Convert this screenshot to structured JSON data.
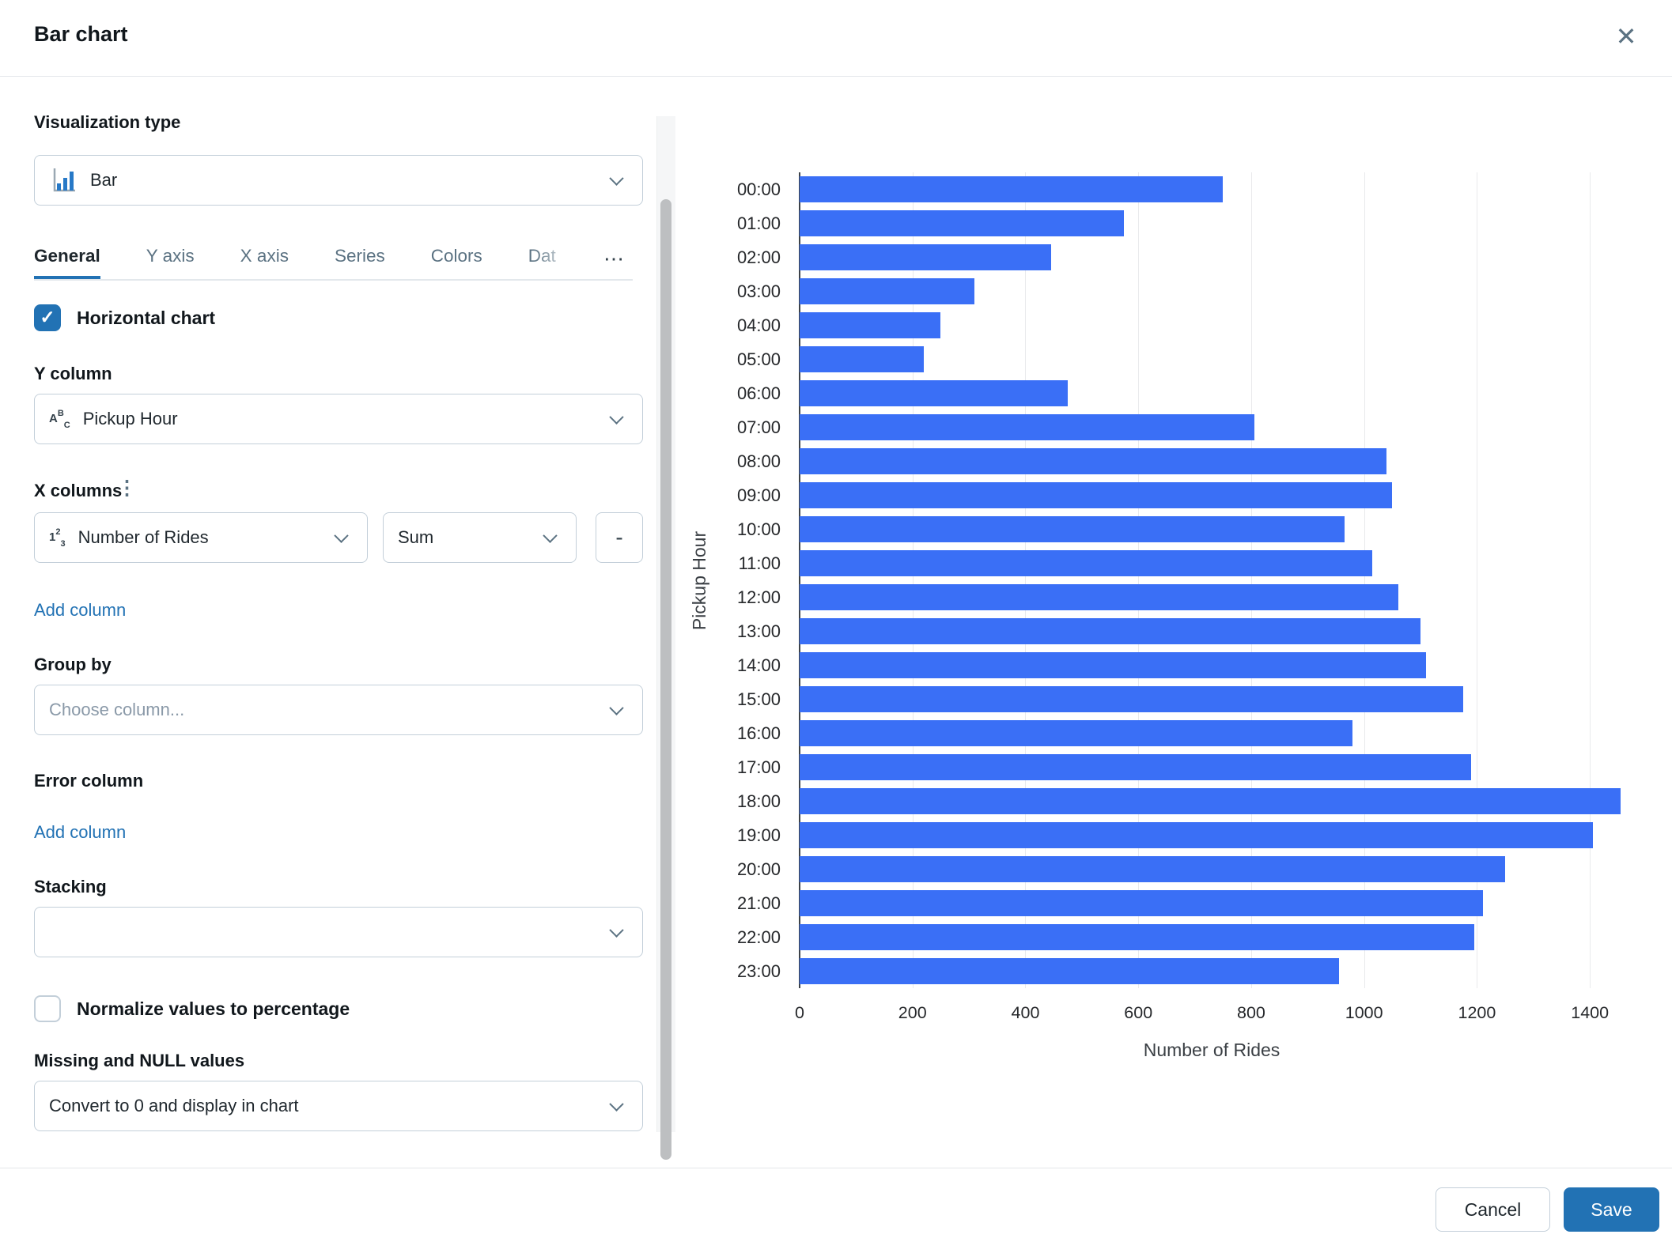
{
  "dialog": {
    "title": "Bar chart"
  },
  "icons": {
    "close": "✕",
    "overflow": "⋯",
    "more_vertical": "⋮",
    "check": "✓",
    "string_type": [
      "A",
      "B",
      "C"
    ],
    "number_type": [
      "1",
      "2",
      "3"
    ]
  },
  "panel": {
    "visualization_type": {
      "label": "Visualization type",
      "value": "Bar"
    },
    "tabs": [
      {
        "label": "General",
        "active": true
      },
      {
        "label": "Y axis",
        "active": false
      },
      {
        "label": "X axis",
        "active": false
      },
      {
        "label": "Series",
        "active": false
      },
      {
        "label": "Colors",
        "active": false
      },
      {
        "label": "Dat",
        "active": false,
        "truncated": true
      }
    ],
    "horizontal_chart": {
      "label": "Horizontal chart",
      "checked": true
    },
    "y_column": {
      "label": "Y column",
      "value": "Pickup Hour"
    },
    "x_columns": {
      "label": "X columns",
      "column": "Number of Rides",
      "aggregation": "Sum",
      "remove_label": "-",
      "add_link": "Add column"
    },
    "group_by": {
      "label": "Group by",
      "placeholder": "Choose column..."
    },
    "error_column": {
      "label": "Error column",
      "add_link": "Add column"
    },
    "stacking": {
      "label": "Stacking",
      "value": ""
    },
    "normalize": {
      "label": "Normalize values to percentage",
      "checked": false
    },
    "missing_null": {
      "label": "Missing and NULL values",
      "value": "Convert to 0 and display in chart"
    }
  },
  "footer": {
    "cancel": "Cancel",
    "save": "Save"
  },
  "colors": {
    "accent": "#2272B4",
    "bar": "#3A6FF6",
    "gridline": "#E9EAEC"
  },
  "chart_data": {
    "type": "bar",
    "orientation": "horizontal",
    "title": "",
    "xlabel": "Number of Rides",
    "ylabel": "Pickup Hour",
    "categories": [
      "00:00",
      "01:00",
      "02:00",
      "03:00",
      "04:00",
      "05:00",
      "06:00",
      "07:00",
      "08:00",
      "09:00",
      "10:00",
      "11:00",
      "12:00",
      "13:00",
      "14:00",
      "15:00",
      "16:00",
      "17:00",
      "18:00",
      "19:00",
      "20:00",
      "21:00",
      "22:00",
      "23:00"
    ],
    "values": [
      750,
      575,
      445,
      310,
      250,
      220,
      475,
      805,
      1040,
      1050,
      965,
      1015,
      1060,
      1100,
      1110,
      1175,
      980,
      1190,
      1455,
      1405,
      1250,
      1210,
      1195,
      955
    ],
    "xticks": [
      0,
      200,
      400,
      600,
      800,
      1000,
      1200,
      1400
    ],
    "xlim": [
      0,
      1460
    ],
    "grid": true,
    "legend": false,
    "bar_color": "#3A6FF6"
  }
}
